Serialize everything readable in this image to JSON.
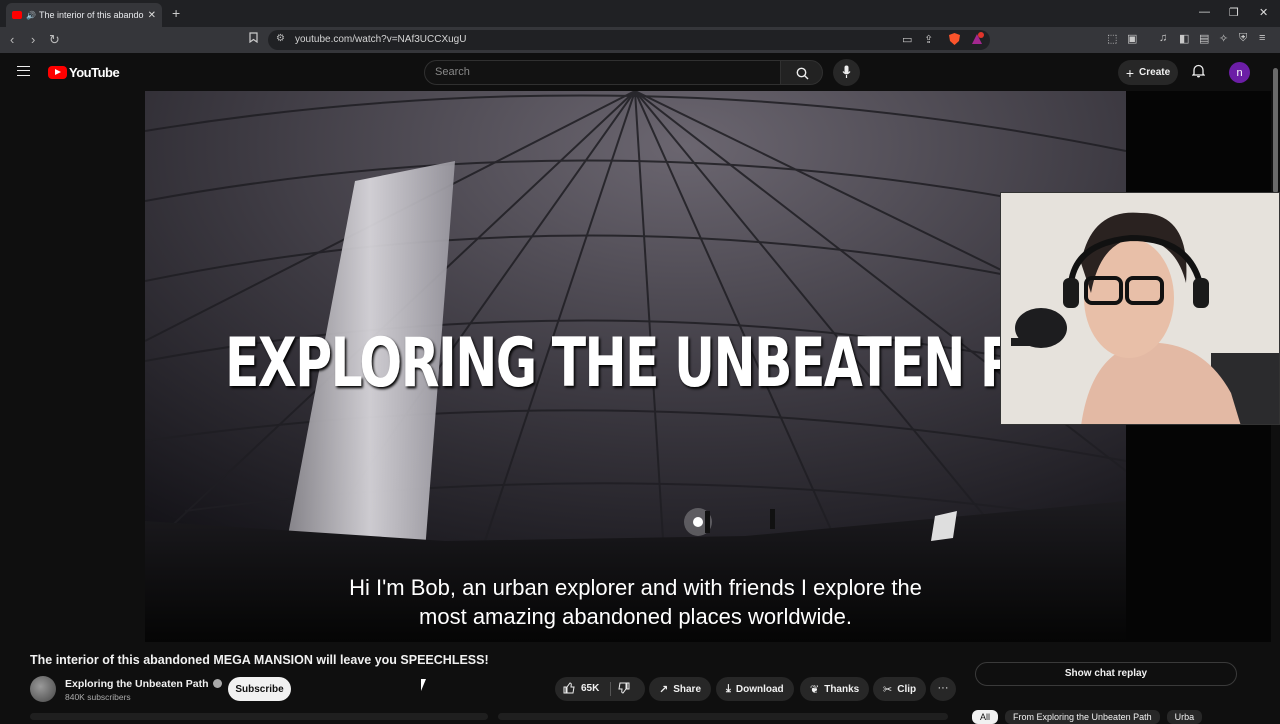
{
  "browser": {
    "tab_title": "The interior of this abandone",
    "new_tab_symbol": "+",
    "tab_close": "✕",
    "url": "youtube.com/watch?v=NAf3UCCXugU",
    "window_controls": [
      "—",
      "❐",
      "✕"
    ],
    "notification_count": "1"
  },
  "youtube": {
    "logo_text": "YouTube",
    "search_placeholder": "Search",
    "create_label": "Create",
    "avatar_letter": "n"
  },
  "video": {
    "overlay_title": "EXPLORING THE UNBEATEN PAT",
    "caption_line1": "Hi I'm Bob, an urban explorer and with friends I explore the",
    "caption_line2": "most amazing abandoned places worldwide."
  },
  "meta": {
    "title": "The interior of this abandoned MEGA MANSION will leave you SPEECHLESS!",
    "channel_name": "Exploring the Unbeaten Path",
    "subscribers": "840K subscribers",
    "subscribe_label": "Subscribe",
    "like_count": "65K",
    "share_label": "Share",
    "download_label": "Download",
    "thanks_label": "Thanks",
    "clip_label": "Clip",
    "more_label": "···"
  },
  "sidebar": {
    "chat_replay_label": "Show chat replay",
    "chips": [
      "All",
      "From Exploring the Unbeaten Path",
      "Urba"
    ]
  }
}
